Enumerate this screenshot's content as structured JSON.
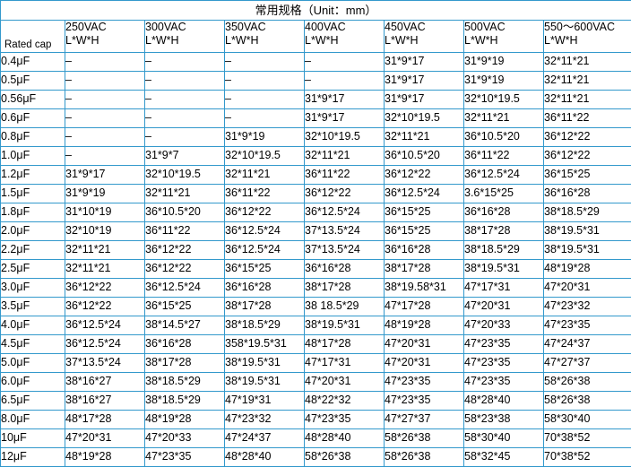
{
  "title": "常用规格（Unit：mm）",
  "corner_label": "Rated cap",
  "columns": [
    {
      "voltage": "250VAC",
      "dims": "L*W*H"
    },
    {
      "voltage": "300VAC",
      "dims": "L*W*H"
    },
    {
      "voltage": "350VAC",
      "dims": "L*W*H"
    },
    {
      "voltage": "400VAC",
      "dims": "L*W*H"
    },
    {
      "voltage": "450VAC",
      "dims": "L*W*H"
    },
    {
      "voltage": "500VAC",
      "dims": "L*W*H"
    },
    {
      "voltage": "550～600VAC",
      "dims": "L*W*H"
    }
  ],
  "rows": [
    {
      "cap": "0.4μF",
      "cells": [
        "–",
        "–",
        "–",
        "–",
        "31*9*17",
        "31*9*19",
        "32*11*21"
      ]
    },
    {
      "cap": "0.5μF",
      "cells": [
        "–",
        "–",
        "–",
        "–",
        "31*9*17",
        "31*9*19",
        "32*11*21"
      ]
    },
    {
      "cap": "0.56μF",
      "cells": [
        "–",
        "–",
        "–",
        "31*9*17",
        "31*9*17",
        "32*10*19.5",
        "32*11*21"
      ]
    },
    {
      "cap": "0.6μF",
      "cells": [
        "–",
        "–",
        "–",
        "31*9*17",
        "32*10*19.5",
        "32*11*21",
        "36*11*22"
      ]
    },
    {
      "cap": "0.8μF",
      "cells": [
        "–",
        "–",
        "31*9*19",
        "32*10*19.5",
        "32*11*21",
        "36*10.5*20",
        "36*12*22"
      ]
    },
    {
      "cap": "1.0μF",
      "cells": [
        "–",
        "31*9*7",
        "32*10*19.5",
        "32*11*21",
        "36*10.5*20",
        "36*11*22",
        "36*12*22"
      ]
    },
    {
      "cap": "1.2μF",
      "cells": [
        "31*9*17",
        "32*10*19.5",
        "32*11*21",
        "36*11*22",
        "36*12*22",
        "36*12.5*24",
        "36*15*25"
      ]
    },
    {
      "cap": "1.5μF",
      "cells": [
        "31*9*19",
        "32*11*21",
        "36*11*22",
        "36*12*22",
        "36*12.5*24",
        "3.6*15*25",
        "36*16*28"
      ]
    },
    {
      "cap": "1.8μF",
      "cells": [
        "31*10*19",
        "36*10.5*20",
        "36*12*22",
        "36*12.5*24",
        "36*15*25",
        "36*16*28",
        "38*18.5*29"
      ]
    },
    {
      "cap": "2.0μF",
      "cells": [
        "32*10*19",
        "36*11*22",
        "36*12.5*24",
        "37*13.5*24",
        "36*15*25",
        "38*17*28",
        "38*19.5*31"
      ]
    },
    {
      "cap": "2.2μF",
      "cells": [
        "32*11*21",
        "36*12*22",
        "36*12.5*24",
        "37*13.5*24",
        "36*16*28",
        "38*18.5*29",
        "38*19.5*31"
      ]
    },
    {
      "cap": "2.5μF",
      "cells": [
        "32*11*21",
        "36*12*22",
        "36*15*25",
        "36*16*28",
        "38*17*28",
        "38*19.5*31",
        "48*19*28"
      ]
    },
    {
      "cap": "3.0μF",
      "cells": [
        "36*12*22",
        "36*12.5*24",
        "36*16*28",
        "38*17*28",
        "38*19.58*31",
        "47*17*31",
        "47*20*31"
      ]
    },
    {
      "cap": "3.5μF",
      "cells": [
        "36*12*22",
        "36*15*25",
        "38*17*28",
        "38 18.5*29",
        "47*17*28",
        "47*20*31",
        "47*23*32"
      ]
    },
    {
      "cap": "4.0μF",
      "cells": [
        "36*12.5*24",
        "38*14.5*27",
        "38*18.5*29",
        "38*19.5*31",
        "48*19*28",
        "47*20*33",
        "47*23*35"
      ]
    },
    {
      "cap": "4.5μF",
      "cells": [
        "36*12.5*24",
        "36*16*28",
        "358*19.5*31",
        "48*17*28",
        "47*20*31",
        "47*23*35",
        "47*24*37"
      ]
    },
    {
      "cap": "5.0μF",
      "cells": [
        "37*13.5*24",
        "38*17*28",
        "38*19.5*31",
        "47*17*31",
        "47*20*31",
        "47*23*35",
        "47*27*37"
      ]
    },
    {
      "cap": "6.0μF",
      "cells": [
        "38*16*27",
        "38*18.5*29",
        "38*19.5*31",
        "47*20*31",
        "47*23*35",
        "47*23*35",
        "58*26*38"
      ]
    },
    {
      "cap": "6.5μF",
      "cells": [
        "38*16*27",
        "38*18.5*29",
        "47*19*31",
        "48*22*32",
        "47*23*35",
        "48*28*40",
        "58*26*38"
      ]
    },
    {
      "cap": "8.0μF",
      "cells": [
        "48*17*28",
        "48*19*28",
        "47*23*32",
        "47*23*35",
        "47*27*37",
        "58*23*38",
        "58*30*40"
      ]
    },
    {
      "cap": "10μF",
      "cells": [
        "47*20*31",
        "47*20*33",
        "47*24*37",
        "48*28*40",
        "58*26*38",
        "58*30*40",
        "70*38*52"
      ]
    },
    {
      "cap": "12μF",
      "cells": [
        "48*19*28",
        "47*23*35",
        "48*28*40",
        "58*26*38",
        "58*26*38",
        "58*32*45",
        "70*38*52"
      ]
    }
  ]
}
